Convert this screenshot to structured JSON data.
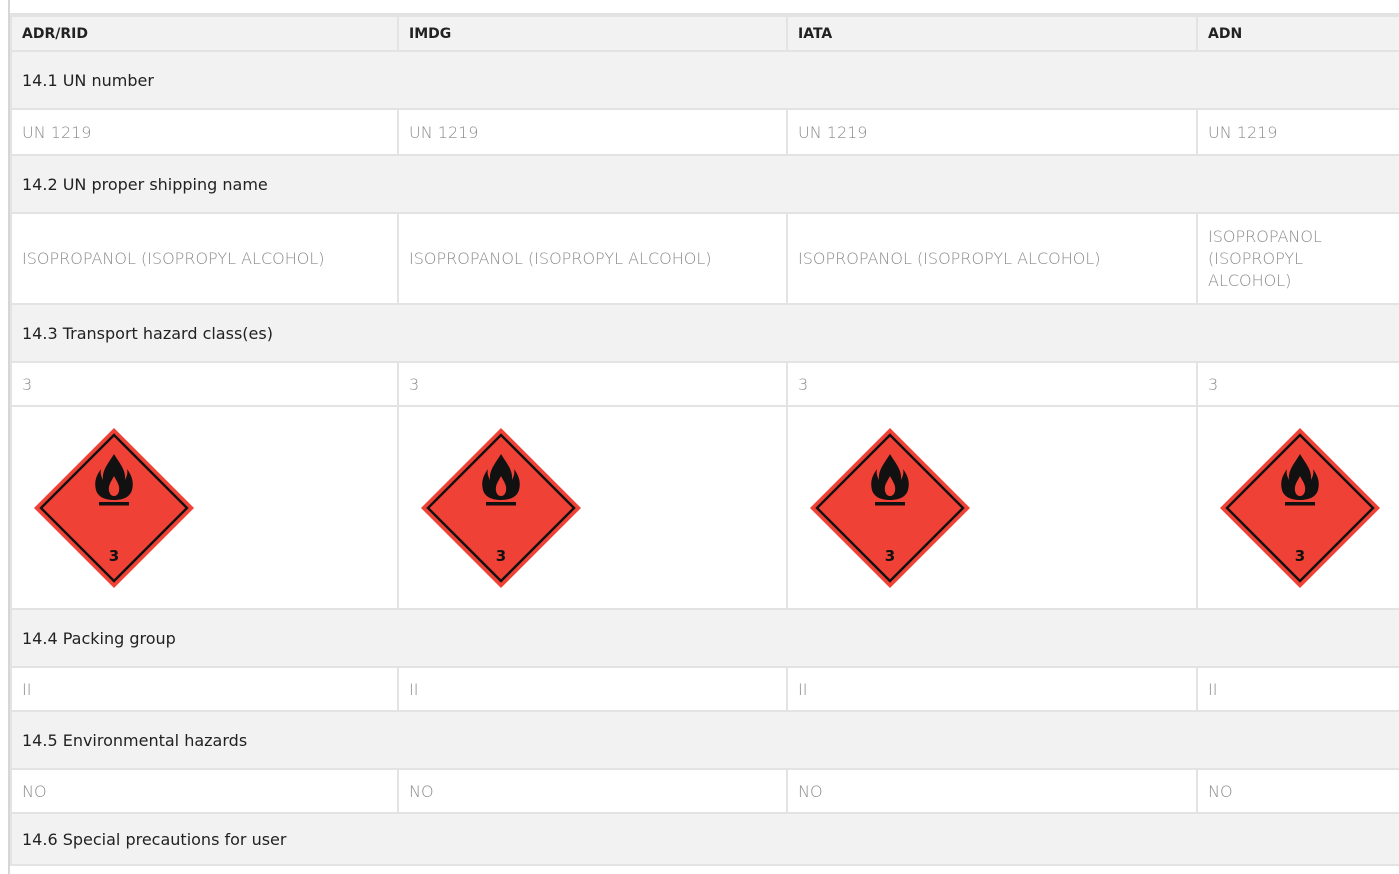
{
  "columns": [
    "ADR/RID",
    "IMDG",
    "IATA",
    "ADN"
  ],
  "sections": {
    "un_number": {
      "title": "14.1 UN number",
      "values": [
        "UN 1219",
        "UN 1219",
        "UN 1219",
        "UN 1219"
      ]
    },
    "shipping_name": {
      "title": "14.2 UN proper shipping name",
      "values": [
        "ISOPROPANOL (ISOPROPYL ALCOHOL)",
        "ISOPROPANOL (ISOPROPYL ALCOHOL)",
        "ISOPROPANOL (ISOPROPYL ALCOHOL)",
        "ISOPROPANOL (ISOPROPYL ALCOHOL)"
      ]
    },
    "hazard_class": {
      "title": "14.3 Transport hazard class(es)",
      "values": [
        "3",
        "3",
        "3",
        "3"
      ],
      "pictogram": {
        "icon": "flammable-liquid-class-3-icon",
        "number": "3",
        "color": "#ef4135"
      }
    },
    "packing_group": {
      "title": "14.4 Packing group",
      "values": [
        "II",
        "II",
        "II",
        "II"
      ]
    },
    "environmental": {
      "title": "14.5 Environmental hazards",
      "values": [
        "NO",
        "NO",
        "NO",
        "NO"
      ]
    },
    "special_precautions": {
      "title": "14.6 Special precautions for user"
    }
  }
}
